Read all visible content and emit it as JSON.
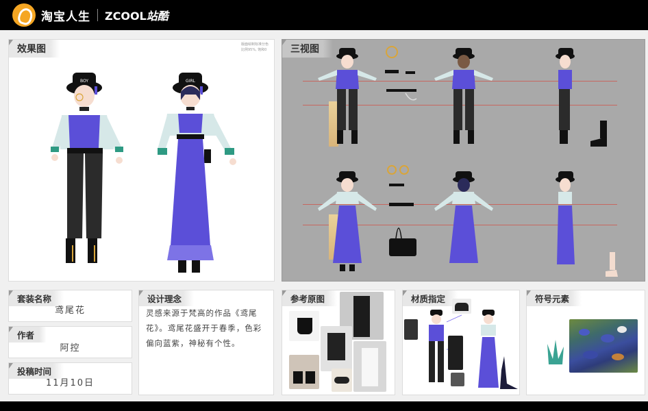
{
  "header": {
    "brand_taobao": "淘宝人生",
    "brand_zcool_a": "ZCOOL",
    "brand_zcool_b": "站酷"
  },
  "panels": {
    "effect": {
      "title": "效果图",
      "note_line1": "版面绘制标准分色",
      "note_line2": "比例95%, 饱和0"
    },
    "three_view": {
      "title": "三视图"
    },
    "suit_name": {
      "title": "套装名称",
      "value": "鸢尾花"
    },
    "author": {
      "title": "作者",
      "value": "阿控"
    },
    "submit_time": {
      "title": "投稿时间",
      "value": "11月10日"
    },
    "concept": {
      "title": "设计理念",
      "text": "灵感来源于梵高的作品《鸢尾花》。鸢尾花盛开于春季，色彩偏向蓝紫，神秘有个性。"
    },
    "reference": {
      "title": "参考原图"
    },
    "material": {
      "title": "材质指定"
    },
    "symbol": {
      "title": "符号元素"
    }
  },
  "hat_labels": {
    "boy": "BOY",
    "girl": "GIRL"
  },
  "colors": {
    "purple": "#5b4fd8",
    "black": "#222222",
    "mint": "#8fcfc4",
    "gray_bg": "#a9a9a9"
  }
}
